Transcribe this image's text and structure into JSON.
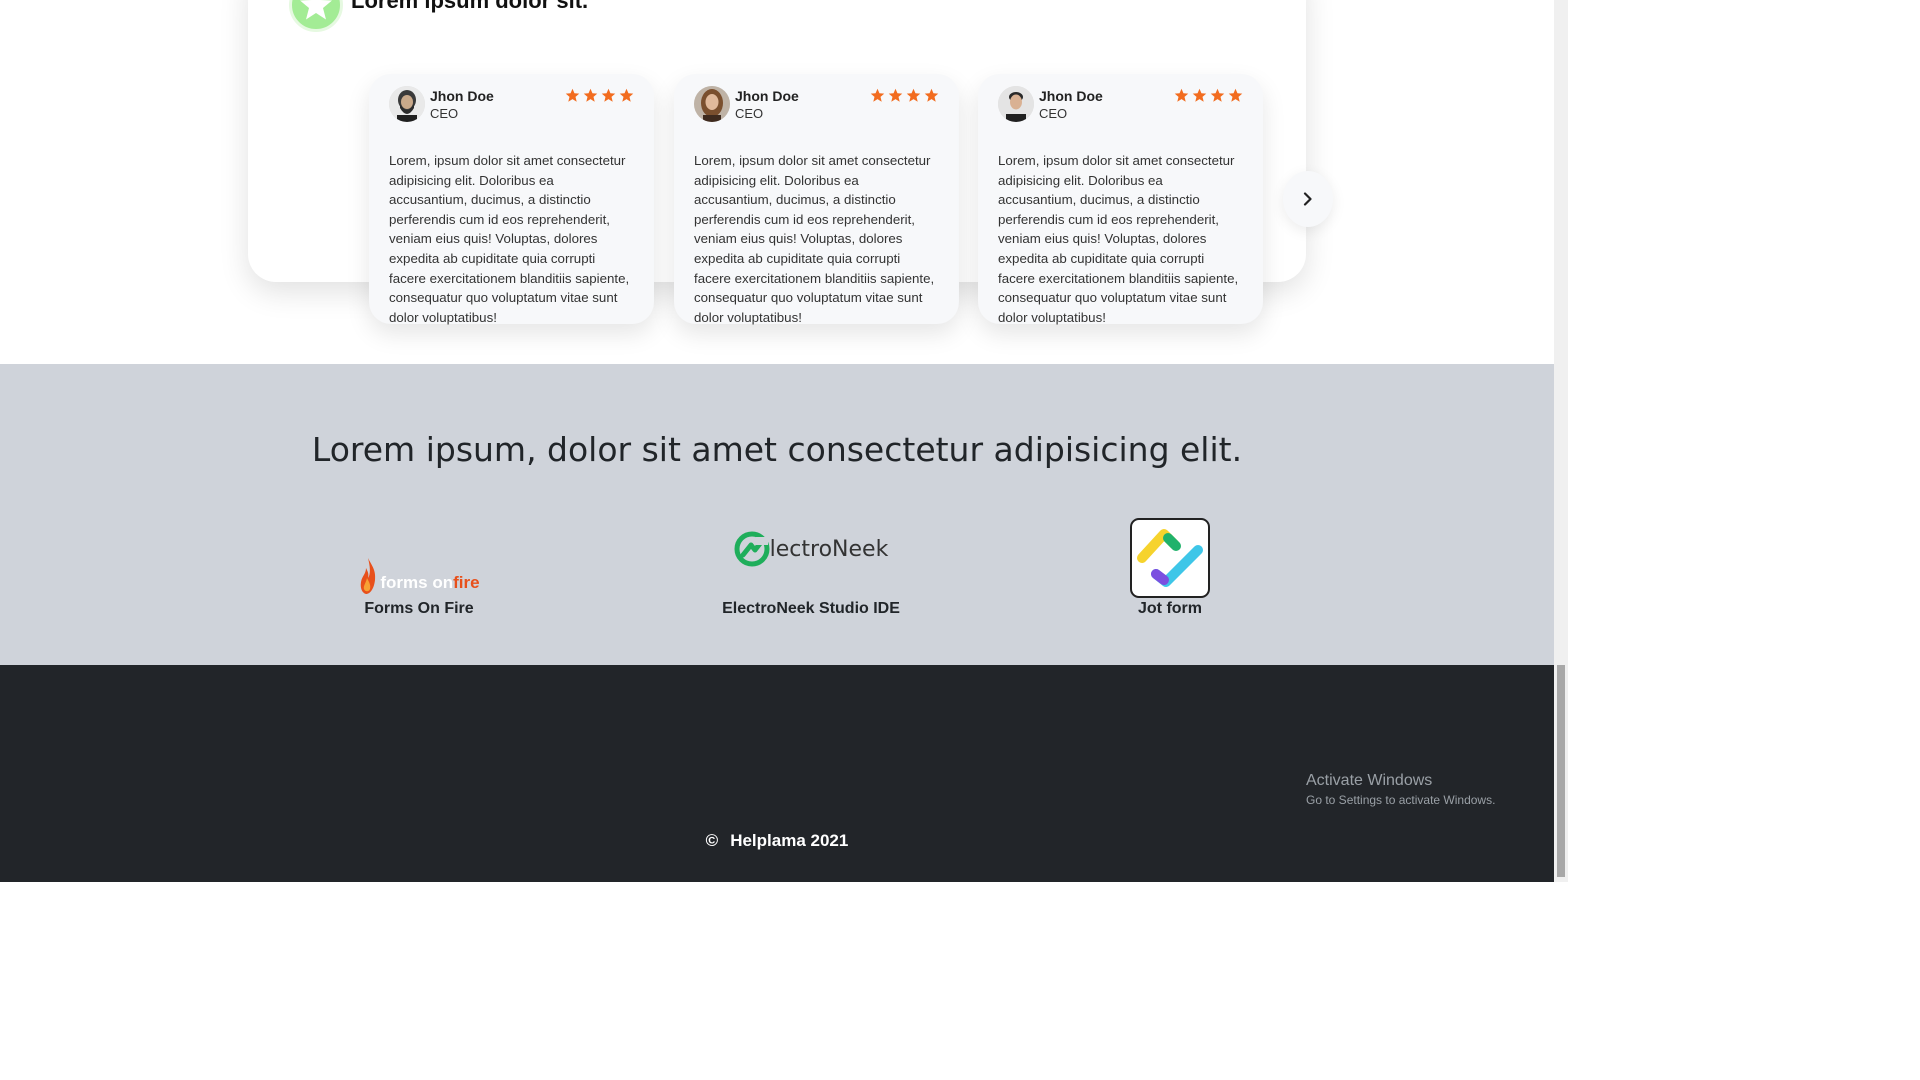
{
  "testimonials_section": {
    "title": "Lorem ipsum dolor sit.",
    "cards": [
      {
        "name": "Jhon Doe",
        "role": "CEO",
        "rating": 4,
        "text": "Lorem, ipsum dolor sit amet consectetur adipisicing elit. Doloribus ea accusantium, ducimus, a distinctio perferendis cum id eos reprehenderit, veniam eius quis! Voluptas, dolores expedita ab cupiditate quia corrupti facere exercitationem blanditiis sapiente, consequatur quo voluptatum vitae sunt dolor voluptatibus!"
      },
      {
        "name": "Jhon Doe",
        "role": "CEO",
        "rating": 4,
        "text": "Lorem, ipsum dolor sit amet consectetur adipisicing elit. Doloribus ea accusantium, ducimus, a distinctio perferendis cum id eos reprehenderit, veniam eius quis! Voluptas, dolores expedita ab cupiditate quia corrupti facere exercitationem blanditiis sapiente, consequatur quo voluptatum vitae sunt dolor voluptatibus!"
      },
      {
        "name": "Jhon Doe",
        "role": "CEO",
        "rating": 4,
        "text": "Lorem, ipsum dolor sit amet consectetur adipisicing elit. Doloribus ea accusantium, ducimus, a distinctio perferendis cum id eos reprehenderit, veniam eius quis! Voluptas, dolores expedita ab cupiditate quia corrupti facere exercitationem blanditiis sapiente, consequatur quo voluptatum vitae sunt dolor voluptatibus!"
      }
    ],
    "next_icon": "chevron-right-icon"
  },
  "partners": {
    "title": "Lorem ipsum, dolor sit amet consectetur adipisicing elit.",
    "items": [
      {
        "name": "Forms On Fire",
        "logo_text_a": "forms on ",
        "logo_text_b": "fire"
      },
      {
        "name": "ElectroNeek Studio IDE",
        "logo_text": "lectroNeek"
      },
      {
        "name": "Jot form"
      }
    ]
  },
  "footer": {
    "copyright_symbol": "©",
    "copyright_text": "Helplama 2021"
  },
  "os_watermark": {
    "title": "Activate Windows",
    "subtitle": "Go to Settings to activate Windows."
  },
  "colors": {
    "star": "#f26c1f",
    "badge": "#a3ec95",
    "partners_bg": "#cfd3da",
    "footer_bg": "#222529",
    "fire_orange": "#e8501b",
    "electroneek_green": "#1fae5b"
  }
}
